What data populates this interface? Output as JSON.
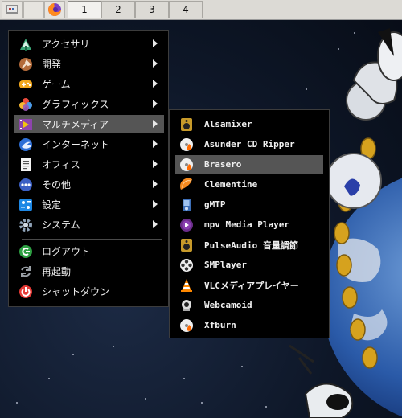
{
  "taskbar": {
    "launchers": [
      {
        "icon": "start-menu-icon"
      },
      {
        "icon": "blank-launcher-icon"
      },
      {
        "icon": "firefox-icon"
      }
    ],
    "workspaces": [
      "1",
      "2",
      "3",
      "4"
    ],
    "active_workspace": "1"
  },
  "main_menu": {
    "items": [
      {
        "label": "アクセサリ",
        "icon": "accessories-icon",
        "submenu": true
      },
      {
        "label": "開発",
        "icon": "development-icon",
        "submenu": true
      },
      {
        "label": "ゲーム",
        "icon": "games-icon",
        "submenu": true
      },
      {
        "label": "グラフィックス",
        "icon": "graphics-icon",
        "submenu": true
      },
      {
        "label": "マルチメディア",
        "icon": "multimedia-icon",
        "submenu": true,
        "highlighted": true
      },
      {
        "label": "インターネット",
        "icon": "internet-icon",
        "submenu": true
      },
      {
        "label": "オフィス",
        "icon": "office-icon",
        "submenu": true
      },
      {
        "label": "その他",
        "icon": "other-icon",
        "submenu": true
      },
      {
        "label": "設定",
        "icon": "settings-icon",
        "submenu": true
      },
      {
        "label": "システム",
        "icon": "system-icon",
        "submenu": true
      }
    ],
    "actions": [
      {
        "label": "ログアウト",
        "icon": "logout-icon"
      },
      {
        "label": "再起動",
        "icon": "reboot-icon"
      },
      {
        "label": "シャットダウン",
        "icon": "shutdown-icon"
      }
    ]
  },
  "multimedia_menu": {
    "items": [
      {
        "label": "Alsamixer",
        "icon": "speaker-icon"
      },
      {
        "label": "Asunder CD Ripper",
        "icon": "cd-burn-icon"
      },
      {
        "label": "Brasero",
        "icon": "cd-burn-icon",
        "highlighted": true
      },
      {
        "label": "Clementine",
        "icon": "clementine-icon"
      },
      {
        "label": "gMTP",
        "icon": "media-player-device-icon"
      },
      {
        "label": "mpv Media Player",
        "icon": "mpv-icon"
      },
      {
        "label": "PulseAudio 音量調節",
        "icon": "speaker-icon"
      },
      {
        "label": "SMPlayer",
        "icon": "film-reel-icon"
      },
      {
        "label": "VLCメディアプレイヤー",
        "icon": "vlc-cone-icon"
      },
      {
        "label": "Webcamoid",
        "icon": "webcam-icon"
      },
      {
        "label": "Xfburn",
        "icon": "cd-burn-icon"
      }
    ]
  },
  "colors": {
    "menu_bg": "#000000",
    "highlight": "#555555",
    "text": "#f0f0f0",
    "taskbar": "#dcdad5"
  }
}
